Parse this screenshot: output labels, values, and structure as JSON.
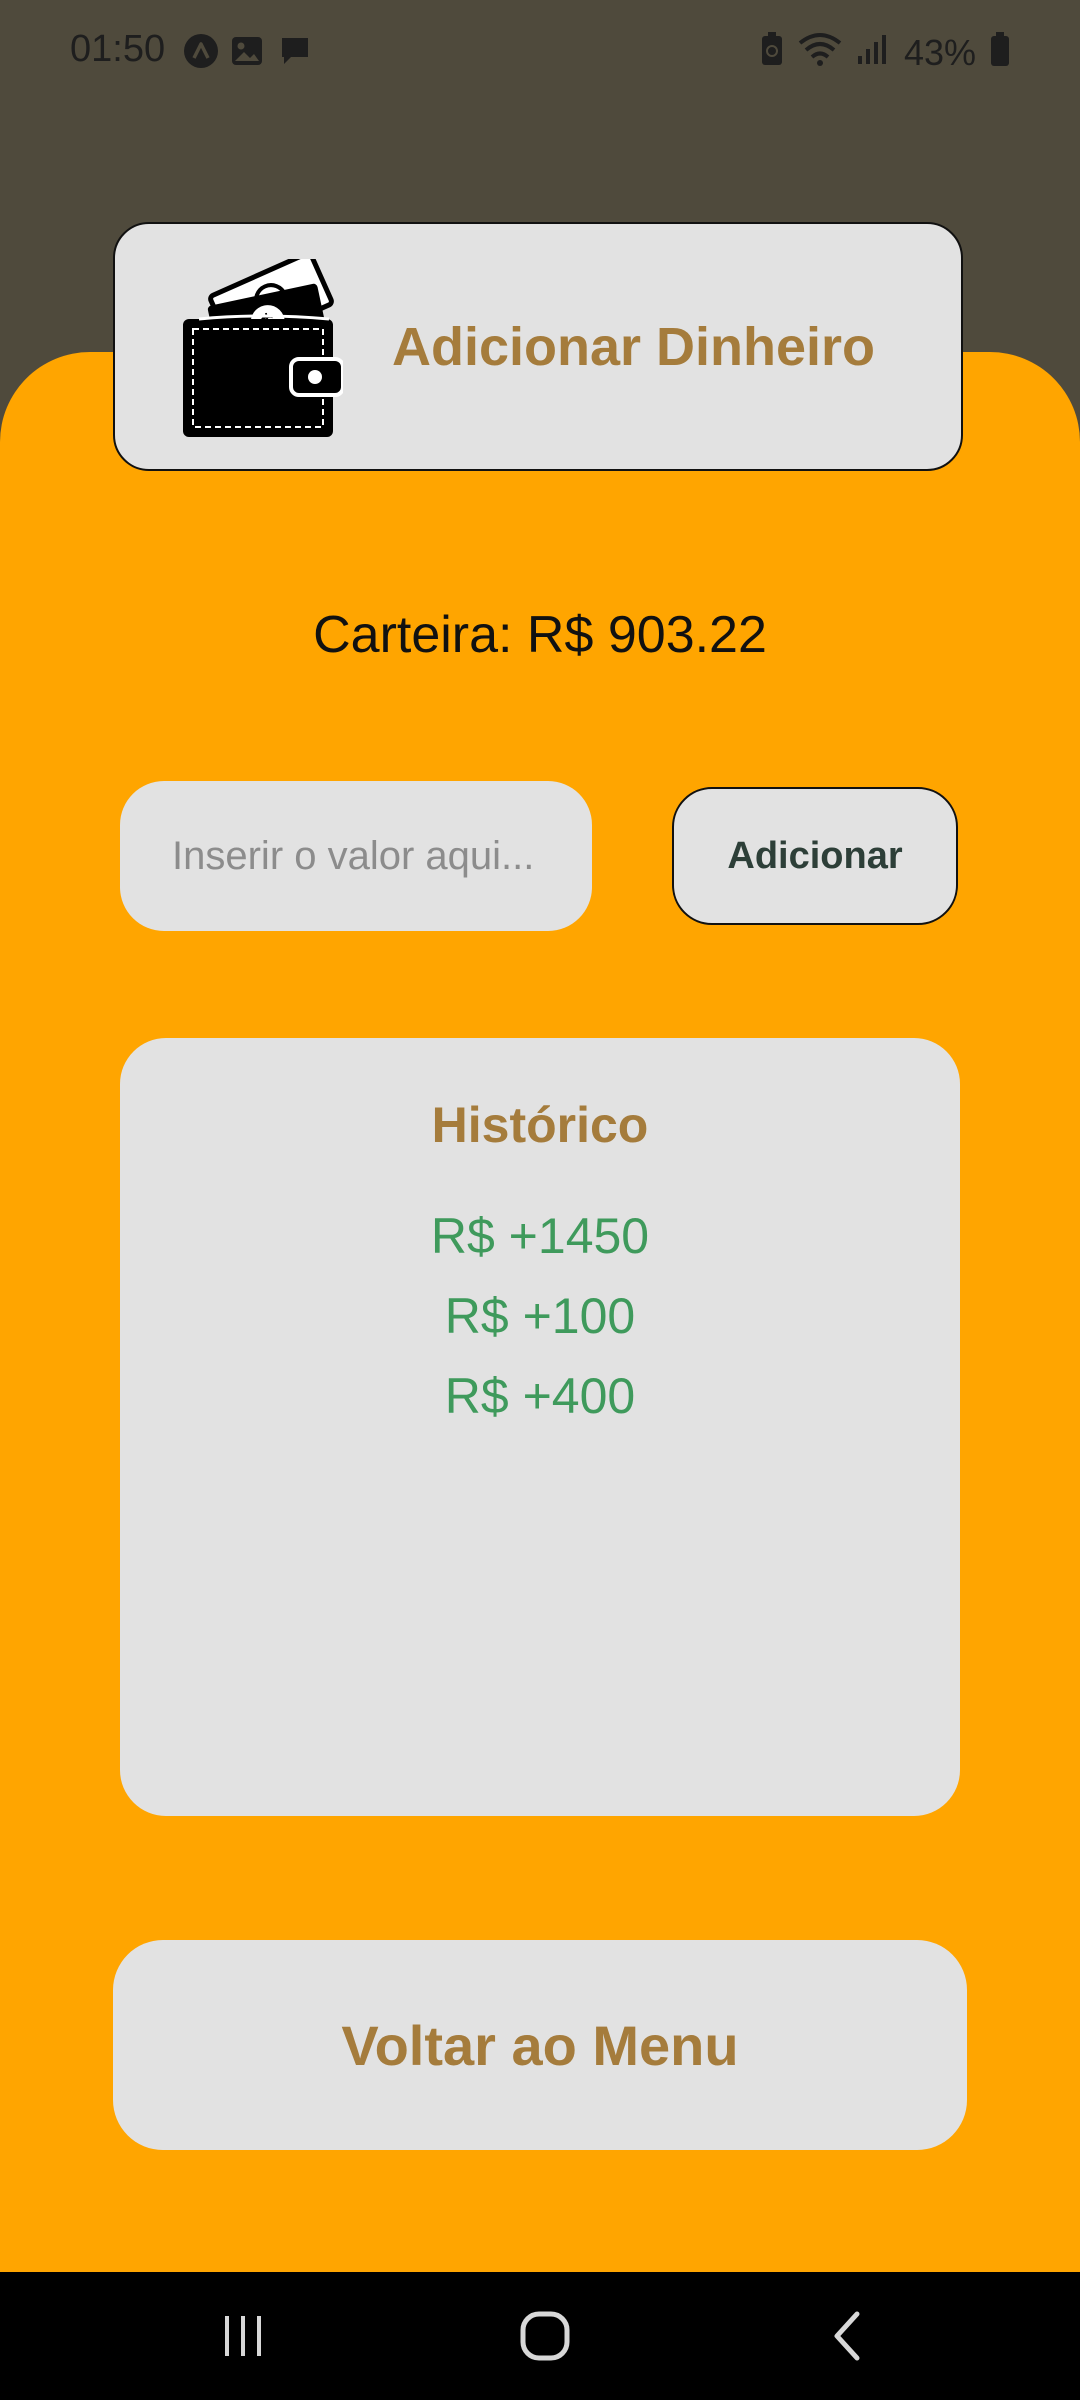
{
  "status_bar": {
    "time": "01:50",
    "left_icons": [
      "app-icon",
      "gallery-icon",
      "message-icon"
    ],
    "right_icons": [
      "battery-saver-icon",
      "wifi-icon",
      "signal-icon"
    ],
    "battery_percent": "43%"
  },
  "header": {
    "title": "Adicionar Dinheiro",
    "icon": "wallet-money-icon"
  },
  "wallet": {
    "balance_text": "Carteira: R$ 903.22"
  },
  "add_form": {
    "input_value": "",
    "input_placeholder": "Inserir o valor aqui...",
    "button_label": "Adicionar"
  },
  "history": {
    "title": "Histórico",
    "items": [
      "R$ +1450",
      "R$ +100",
      "R$ +400"
    ]
  },
  "back_button_label": "Voltar ao Menu",
  "nav_bar": {
    "icons": [
      "recent-apps-icon",
      "home-icon",
      "back-icon"
    ]
  },
  "colors": {
    "status_background": "#4f4a3c",
    "accent_orange": "#FFA500",
    "card_gray": "#e2e2e2",
    "title_brown": "#a57c3c",
    "history_green": "#3f9a5c",
    "button_text": "#2d3f38"
  }
}
